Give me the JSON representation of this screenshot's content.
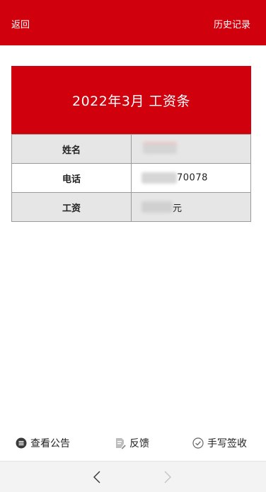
{
  "topbar": {
    "back_label": "返回",
    "history_label": "历史记录",
    "bg_color": "#d0000c"
  },
  "payslip": {
    "title": "2022年3月 工资条",
    "rows": [
      {
        "label": "姓名",
        "value_visible": ""
      },
      {
        "label": "电话",
        "value_visible": "70078"
      },
      {
        "label": "工资",
        "value_visible": "元"
      }
    ]
  },
  "actions": {
    "announcement_label": "查看公告",
    "feedback_label": "反馈",
    "sign_label": "手写签收"
  },
  "icons": {
    "announcement": "list-circle-icon",
    "feedback": "document-edit-icon",
    "sign": "check-circle-icon",
    "back": "chevron-left-icon",
    "forward": "chevron-right-icon"
  }
}
